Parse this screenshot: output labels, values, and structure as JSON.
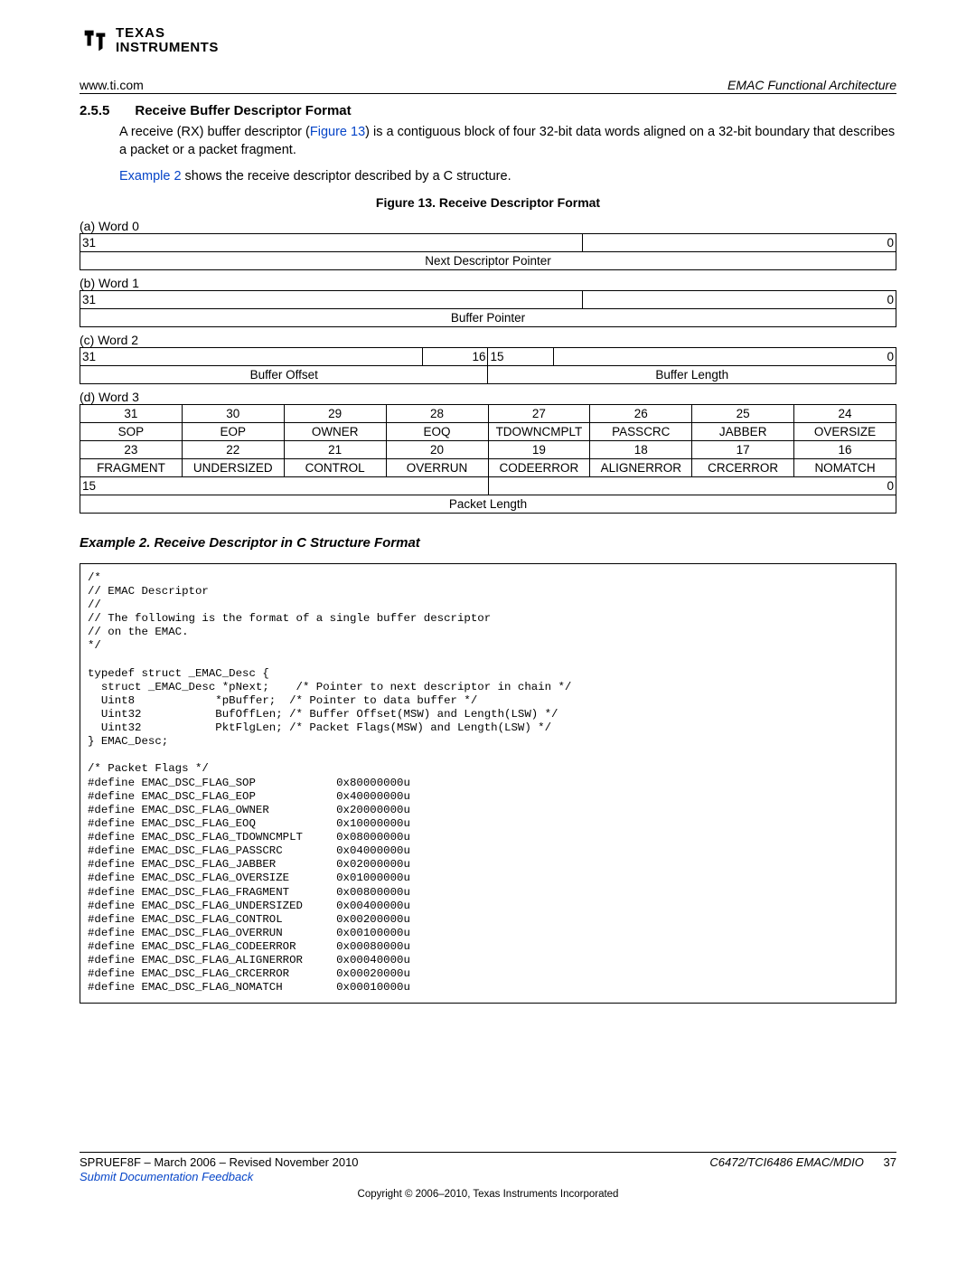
{
  "logo": {
    "line1": "TEXAS",
    "line2": "INSTRUMENTS"
  },
  "header": {
    "url": "www.ti.com",
    "section": "EMAC Functional Architecture"
  },
  "section": {
    "num": "2.5.5",
    "title": "Receive Buffer Descriptor Format"
  },
  "para1_a": "A receive (RX) buffer descriptor (",
  "para1_link": "Figure 13",
  "para1_b": ") is a contiguous block of four 32-bit data words aligned on a 32-bit boundary that describes a packet or a packet fragment.",
  "para2_link": "Example 2",
  "para2_b": " shows the receive descriptor described by a C structure.",
  "figure_title": "Figure 13. Receive Descriptor Format",
  "words": {
    "w0": {
      "label": "(a) Word 0",
      "bits_l": "31",
      "bits_r": "0",
      "field": "Next Descriptor Pointer"
    },
    "w1": {
      "label": "(b) Word 1",
      "bits_l": "31",
      "bits_r": "0",
      "field": "Buffer Pointer"
    },
    "w2": {
      "label": "(c) Word 2",
      "bits_l": "31",
      "bits_m1": "16",
      "bits_m2": "15",
      "bits_r": "0",
      "f1": "Buffer Offset",
      "f2": "Buffer Length"
    },
    "w3": {
      "label": "(d) Word 3",
      "bits1": [
        "31",
        "30",
        "29",
        "28",
        "27",
        "26",
        "25",
        "24"
      ],
      "row1": [
        "SOP",
        "EOP",
        "OWNER",
        "EOQ",
        "TDOWNCMPLT",
        "PASSCRC",
        "JABBER",
        "OVERSIZE"
      ],
      "bits2": [
        "23",
        "22",
        "21",
        "20",
        "19",
        "18",
        "17",
        "16"
      ],
      "row2": [
        "FRAGMENT",
        "UNDERSIZED",
        "CONTROL",
        "OVERRUN",
        "CODEERROR",
        "ALIGNERROR",
        "CRCERROR",
        "NOMATCH"
      ],
      "bits3_l": "15",
      "bits3_r": "0",
      "row3": "Packet Length"
    }
  },
  "example_title": "Example 2. Receive Descriptor in C Structure Format",
  "code": "/*\n// EMAC Descriptor\n//\n// The following is the format of a single buffer descriptor\n// on the EMAC.\n*/\n\ntypedef struct _EMAC_Desc {\n  struct _EMAC_Desc *pNext;    /* Pointer to next descriptor in chain */\n  Uint8            *pBuffer;  /* Pointer to data buffer */\n  Uint32           BufOffLen; /* Buffer Offset(MSW) and Length(LSW) */\n  Uint32           PktFlgLen; /* Packet Flags(MSW) and Length(LSW) */\n} EMAC_Desc;\n\n/* Packet Flags */\n#define EMAC_DSC_FLAG_SOP            0x80000000u\n#define EMAC_DSC_FLAG_EOP            0x40000000u\n#define EMAC_DSC_FLAG_OWNER          0x20000000u\n#define EMAC_DSC_FLAG_EOQ            0x10000000u\n#define EMAC_DSC_FLAG_TDOWNCMPLT     0x08000000u\n#define EMAC_DSC_FLAG_PASSCRC        0x04000000u\n#define EMAC_DSC_FLAG_JABBER         0x02000000u\n#define EMAC_DSC_FLAG_OVERSIZE       0x01000000u\n#define EMAC_DSC_FLAG_FRAGMENT       0x00800000u\n#define EMAC_DSC_FLAG_UNDERSIZED     0x00400000u\n#define EMAC_DSC_FLAG_CONTROL        0x00200000u\n#define EMAC_DSC_FLAG_OVERRUN        0x00100000u\n#define EMAC_DSC_FLAG_CODEERROR      0x00080000u\n#define EMAC_DSC_FLAG_ALIGNERROR     0x00040000u\n#define EMAC_DSC_FLAG_CRCERROR       0x00020000u\n#define EMAC_DSC_FLAG_NOMATCH        0x00010000u\n",
  "footer": {
    "left": "SPRUEF8F – March 2006 – Revised November 2010",
    "right_doc": "C6472/TCI6486 EMAC/MDIO",
    "page": "37",
    "feedback": "Submit Documentation Feedback",
    "copyright": "Copyright © 2006–2010, Texas Instruments Incorporated"
  }
}
